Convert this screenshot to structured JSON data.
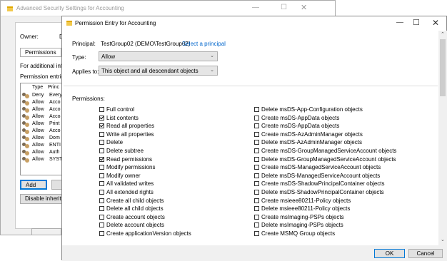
{
  "background_window": {
    "title": "Advanced Security Settings for Accounting",
    "owner_label": "Owner:",
    "owner_value": "Do",
    "tab_label": "Permissions",
    "tab_label_2": "",
    "info_text": "For additional infor",
    "entries_label": "Permission entries:",
    "columns": [
      "Type",
      "Princ"
    ],
    "entries": [
      {
        "type": "Deny",
        "principal": "Every"
      },
      {
        "type": "Allow",
        "principal": "Acco"
      },
      {
        "type": "Allow",
        "principal": "Acco"
      },
      {
        "type": "Allow",
        "principal": "Acco"
      },
      {
        "type": "Allow",
        "principal": "Print"
      },
      {
        "type": "Allow",
        "principal": "Acco"
      },
      {
        "type": "Allow",
        "principal": "Dom"
      },
      {
        "type": "Allow",
        "principal": "ENTI"
      },
      {
        "type": "Allow",
        "principal": "Auth"
      },
      {
        "type": "Allow",
        "principal": "SYST"
      }
    ],
    "add_label": "Add",
    "second_btn_label": "",
    "disable_label": "Disable inheritan"
  },
  "dialog": {
    "title": "Permission Entry for Accounting",
    "principal_label": "Principal:",
    "principal_value": "TestGroup02 (DEMO\\TestGroup02)",
    "select_principal": "Select a principal",
    "type_label": "Type:",
    "type_value": "Allow",
    "applies_label": "Applies to:",
    "applies_value": "This object and all descendant objects",
    "permissions_label": "Permissions:",
    "permissions_left": [
      {
        "label": "Full control",
        "checked": false
      },
      {
        "label": "List contents",
        "checked": true
      },
      {
        "label": "Read all properties",
        "checked": true
      },
      {
        "label": "Write all properties",
        "checked": false
      },
      {
        "label": "Delete",
        "checked": false
      },
      {
        "label": "Delete subtree",
        "checked": false
      },
      {
        "label": "Read permissions",
        "checked": true
      },
      {
        "label": "Modify permissions",
        "checked": false
      },
      {
        "label": "Modify owner",
        "checked": false
      },
      {
        "label": "All validated writes",
        "checked": false
      },
      {
        "label": "All extended rights",
        "checked": false
      },
      {
        "label": "Create all child objects",
        "checked": false
      },
      {
        "label": "Delete all child objects",
        "checked": false
      },
      {
        "label": "Create account objects",
        "checked": false
      },
      {
        "label": "Delete account objects",
        "checked": false
      },
      {
        "label": "Create applicationVersion objects",
        "checked": false
      }
    ],
    "permissions_right": [
      {
        "label": "Delete msDS-App-Configuration objects",
        "checked": false
      },
      {
        "label": "Create msDS-AppData objects",
        "checked": false
      },
      {
        "label": "Create msDS-AppData objects",
        "checked": false
      },
      {
        "label": "Create msDS-AzAdminManager objects",
        "checked": false
      },
      {
        "label": "Delete msDS-AzAdminManager objects",
        "checked": false
      },
      {
        "label": "Create msDS-GroupManagedServiceAccount objects",
        "checked": false
      },
      {
        "label": "Delete msDS-GroupManagedServiceAccount objects",
        "checked": false
      },
      {
        "label": "Create msDS-ManagedServiceAccount objects",
        "checked": false
      },
      {
        "label": "Delete msDS-ManagedServiceAccount objects",
        "checked": false
      },
      {
        "label": "Create msDS-ShadowPrincipalContainer objects",
        "checked": false
      },
      {
        "label": "Delete msDS-ShadowPrincipalContainer objects",
        "checked": false
      },
      {
        "label": "Create msieee80211-Policy objects",
        "checked": false
      },
      {
        "label": "Delete msieee80211-Policy objects",
        "checked": false
      },
      {
        "label": "Create msImaging-PSPs objects",
        "checked": false
      },
      {
        "label": "Delete msImaging-PSPs objects",
        "checked": false
      },
      {
        "label": "Create MSMQ Group objects",
        "checked": false
      }
    ],
    "ok_label": "OK",
    "cancel_label": "Cancel"
  },
  "icons": {
    "window_icon": "folder-icon",
    "principal_icon": "user-group-icon",
    "minimize": "—",
    "maximize": "☐",
    "close": "✕",
    "dropdown": "⌄",
    "scroll_up": "⌃",
    "scroll_down": "⌄"
  },
  "colors": {
    "link": "#0066cc",
    "accent": "#0078d7",
    "checked_mark": "#000000"
  }
}
